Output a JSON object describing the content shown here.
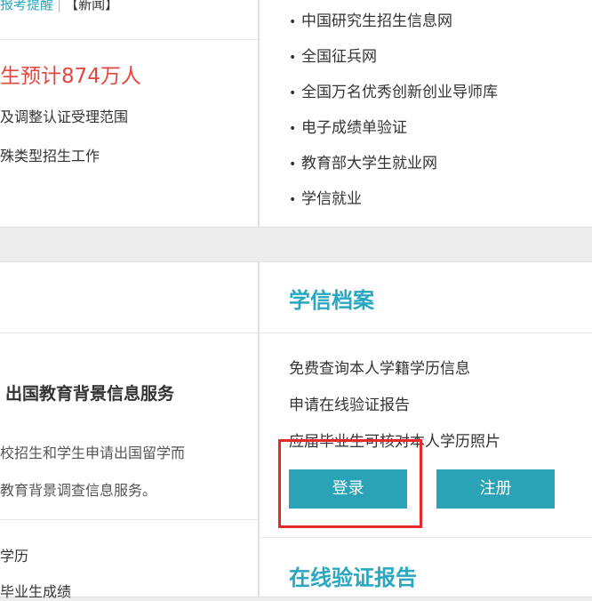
{
  "news": {
    "top_link": "报考提醒",
    "separator": "|",
    "top_tag": "【新闻】",
    "headline": "生预计874万人",
    "lines": [
      "及调整认证受理范围",
      "殊类型招生工作"
    ]
  },
  "links": {
    "bullet": "•",
    "items": [
      "中国研究生招生信息网",
      "全国征兵网",
      "全国万名优秀创新创业导师库",
      "电子成绩单验证",
      "教育部大学生就业网",
      "学信就业"
    ]
  },
  "archive": {
    "title": "学信档案",
    "features": [
      "免费查询本人学籍学历信息",
      "申请在线验证报告",
      "应届毕业生可核对本人学历照片"
    ],
    "login_label": "登录",
    "register_label": "注册"
  },
  "overseas": {
    "title": "出国教育背景信息服务",
    "desc_lines": [
      "校招生和学生申请出国留学而",
      "教育背景调查信息服务。"
    ],
    "items": [
      "学历",
      "毕业生成绩"
    ]
  },
  "verify": {
    "title": "在线验证报告"
  },
  "colors": {
    "accent": "#2aa7c0",
    "button": "#2aa3b6",
    "headline_red": "#e5463e",
    "highlight_red": "#e52a2a"
  }
}
